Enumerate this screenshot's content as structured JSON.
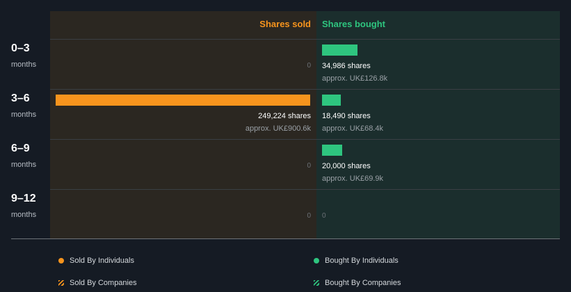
{
  "headers": {
    "sold": "Shares sold",
    "bought": "Shares bought"
  },
  "chart_data": {
    "type": "bar",
    "categories": [
      "0–3 months",
      "3–6 months",
      "6–9 months",
      "9–12 months"
    ],
    "series": [
      {
        "name": "Shares sold",
        "values": [
          0,
          249224,
          0,
          0
        ]
      },
      {
        "name": "Shares bought",
        "values": [
          34986,
          18490,
          20000,
          0
        ]
      }
    ]
  },
  "rows": [
    {
      "period": "0–3",
      "unit": "months",
      "sold": {
        "shares": 0,
        "shares_label": "",
        "approx_label": "",
        "zero_label": "0"
      },
      "bought": {
        "shares": 34986,
        "shares_label": "34,986 shares",
        "approx_label": "approx. UK£126.8k",
        "zero_label": ""
      }
    },
    {
      "period": "3–6",
      "unit": "months",
      "sold": {
        "shares": 249224,
        "shares_label": "249,224 shares",
        "approx_label": "approx. UK£900.6k",
        "zero_label": ""
      },
      "bought": {
        "shares": 18490,
        "shares_label": "18,490 shares",
        "approx_label": "approx. UK£68.4k",
        "zero_label": ""
      }
    },
    {
      "period": "6–9",
      "unit": "months",
      "sold": {
        "shares": 0,
        "shares_label": "",
        "approx_label": "",
        "zero_label": "0"
      },
      "bought": {
        "shares": 20000,
        "shares_label": "20,000 shares",
        "approx_label": "approx. UK£69.9k",
        "zero_label": ""
      }
    },
    {
      "period": "9–12",
      "unit": "months",
      "sold": {
        "shares": 0,
        "shares_label": "",
        "approx_label": "",
        "zero_label": "0"
      },
      "bought": {
        "shares": 0,
        "shares_label": "",
        "approx_label": "",
        "zero_label": "0"
      }
    }
  ],
  "legend": {
    "sold_individuals": "Sold By Individuals",
    "bought_individuals": "Bought By Individuals",
    "sold_companies": "Sold By Companies",
    "bought_companies": "Bought By Companies"
  },
  "colors": {
    "sold": "#f7941d",
    "bought": "#2ec57f",
    "background": "#151b24",
    "sold_panel": "#2b2721",
    "bought_panel": "#1b2e2d"
  }
}
